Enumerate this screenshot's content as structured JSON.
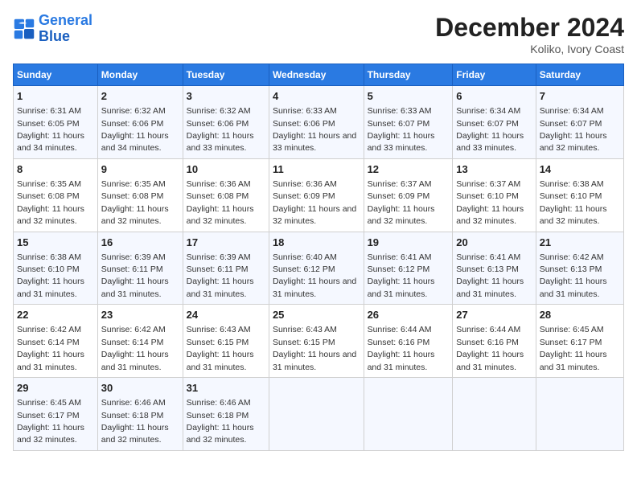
{
  "logo": {
    "line1": "General",
    "line2": "Blue"
  },
  "title": "December 2024",
  "subtitle": "Koliko, Ivory Coast",
  "header": {
    "days": [
      "Sunday",
      "Monday",
      "Tuesday",
      "Wednesday",
      "Thursday",
      "Friday",
      "Saturday"
    ]
  },
  "weeks": [
    [
      {
        "day": "1",
        "sunrise": "6:31 AM",
        "sunset": "6:05 PM",
        "daylight": "11 hours and 34 minutes."
      },
      {
        "day": "2",
        "sunrise": "6:32 AM",
        "sunset": "6:06 PM",
        "daylight": "11 hours and 34 minutes."
      },
      {
        "day": "3",
        "sunrise": "6:32 AM",
        "sunset": "6:06 PM",
        "daylight": "11 hours and 33 minutes."
      },
      {
        "day": "4",
        "sunrise": "6:33 AM",
        "sunset": "6:06 PM",
        "daylight": "11 hours and 33 minutes."
      },
      {
        "day": "5",
        "sunrise": "6:33 AM",
        "sunset": "6:07 PM",
        "daylight": "11 hours and 33 minutes."
      },
      {
        "day": "6",
        "sunrise": "6:34 AM",
        "sunset": "6:07 PM",
        "daylight": "11 hours and 33 minutes."
      },
      {
        "day": "7",
        "sunrise": "6:34 AM",
        "sunset": "6:07 PM",
        "daylight": "11 hours and 32 minutes."
      }
    ],
    [
      {
        "day": "8",
        "sunrise": "6:35 AM",
        "sunset": "6:08 PM",
        "daylight": "11 hours and 32 minutes."
      },
      {
        "day": "9",
        "sunrise": "6:35 AM",
        "sunset": "6:08 PM",
        "daylight": "11 hours and 32 minutes."
      },
      {
        "day": "10",
        "sunrise": "6:36 AM",
        "sunset": "6:08 PM",
        "daylight": "11 hours and 32 minutes."
      },
      {
        "day": "11",
        "sunrise": "6:36 AM",
        "sunset": "6:09 PM",
        "daylight": "11 hours and 32 minutes."
      },
      {
        "day": "12",
        "sunrise": "6:37 AM",
        "sunset": "6:09 PM",
        "daylight": "11 hours and 32 minutes."
      },
      {
        "day": "13",
        "sunrise": "6:37 AM",
        "sunset": "6:10 PM",
        "daylight": "11 hours and 32 minutes."
      },
      {
        "day": "14",
        "sunrise": "6:38 AM",
        "sunset": "6:10 PM",
        "daylight": "11 hours and 32 minutes."
      }
    ],
    [
      {
        "day": "15",
        "sunrise": "6:38 AM",
        "sunset": "6:10 PM",
        "daylight": "11 hours and 31 minutes."
      },
      {
        "day": "16",
        "sunrise": "6:39 AM",
        "sunset": "6:11 PM",
        "daylight": "11 hours and 31 minutes."
      },
      {
        "day": "17",
        "sunrise": "6:39 AM",
        "sunset": "6:11 PM",
        "daylight": "11 hours and 31 minutes."
      },
      {
        "day": "18",
        "sunrise": "6:40 AM",
        "sunset": "6:12 PM",
        "daylight": "11 hours and 31 minutes."
      },
      {
        "day": "19",
        "sunrise": "6:41 AM",
        "sunset": "6:12 PM",
        "daylight": "11 hours and 31 minutes."
      },
      {
        "day": "20",
        "sunrise": "6:41 AM",
        "sunset": "6:13 PM",
        "daylight": "11 hours and 31 minutes."
      },
      {
        "day": "21",
        "sunrise": "6:42 AM",
        "sunset": "6:13 PM",
        "daylight": "11 hours and 31 minutes."
      }
    ],
    [
      {
        "day": "22",
        "sunrise": "6:42 AM",
        "sunset": "6:14 PM",
        "daylight": "11 hours and 31 minutes."
      },
      {
        "day": "23",
        "sunrise": "6:42 AM",
        "sunset": "6:14 PM",
        "daylight": "11 hours and 31 minutes."
      },
      {
        "day": "24",
        "sunrise": "6:43 AM",
        "sunset": "6:15 PM",
        "daylight": "11 hours and 31 minutes."
      },
      {
        "day": "25",
        "sunrise": "6:43 AM",
        "sunset": "6:15 PM",
        "daylight": "11 hours and 31 minutes."
      },
      {
        "day": "26",
        "sunrise": "6:44 AM",
        "sunset": "6:16 PM",
        "daylight": "11 hours and 31 minutes."
      },
      {
        "day": "27",
        "sunrise": "6:44 AM",
        "sunset": "6:16 PM",
        "daylight": "11 hours and 31 minutes."
      },
      {
        "day": "28",
        "sunrise": "6:45 AM",
        "sunset": "6:17 PM",
        "daylight": "11 hours and 31 minutes."
      }
    ],
    [
      {
        "day": "29",
        "sunrise": "6:45 AM",
        "sunset": "6:17 PM",
        "daylight": "11 hours and 32 minutes."
      },
      {
        "day": "30",
        "sunrise": "6:46 AM",
        "sunset": "6:18 PM",
        "daylight": "11 hours and 32 minutes."
      },
      {
        "day": "31",
        "sunrise": "6:46 AM",
        "sunset": "6:18 PM",
        "daylight": "11 hours and 32 minutes."
      },
      null,
      null,
      null,
      null
    ]
  ]
}
